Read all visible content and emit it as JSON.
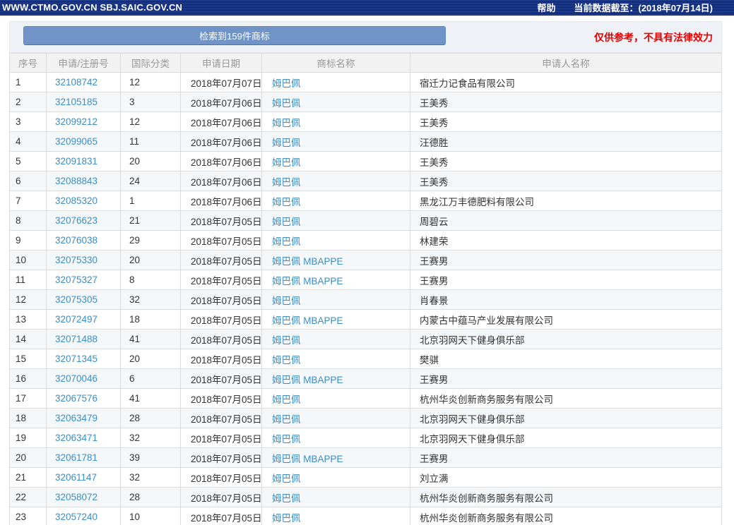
{
  "topbar": {
    "title": "WWW.CTMO.GOV.CN SBJ.SAIC.GOV.CN",
    "help_label": "帮助",
    "data_cutoff": "当前数据截至：(2018年07月14日)"
  },
  "toolbar": {
    "result_count_label": "检索到159件商标",
    "disclaimer": "仅供参考，不具有法律效力"
  },
  "colors": {
    "topbar_base": "#142f80",
    "topbar_stripe": "#24418f",
    "button_blue": "#7094c8",
    "link_blue": "#3d8dc4",
    "disclaimer_red": "#e60000",
    "row_alt": "#f5f8fb",
    "header_bg": "#f2f2f2"
  },
  "table": {
    "columns": [
      "序号",
      "申请/注册号",
      "国际分类",
      "申请日期",
      "商标名称",
      "申请人名称"
    ],
    "rows": [
      {
        "no": "1",
        "reg_no": "32108742",
        "cls": "12",
        "date": "2018年07月07日",
        "mark": "姆巴佩",
        "applicant": "宿迁力记食品有限公司"
      },
      {
        "no": "2",
        "reg_no": "32105185",
        "cls": "3",
        "date": "2018年07月06日",
        "mark": "姆巴佩",
        "applicant": "王美秀"
      },
      {
        "no": "3",
        "reg_no": "32099212",
        "cls": "12",
        "date": "2018年07月06日",
        "mark": "姆巴佩",
        "applicant": "王美秀"
      },
      {
        "no": "4",
        "reg_no": "32099065",
        "cls": "11",
        "date": "2018年07月06日",
        "mark": "姆巴佩",
        "applicant": "汪德胜"
      },
      {
        "no": "5",
        "reg_no": "32091831",
        "cls": "20",
        "date": "2018年07月06日",
        "mark": "姆巴佩",
        "applicant": "王美秀"
      },
      {
        "no": "6",
        "reg_no": "32088843",
        "cls": "24",
        "date": "2018年07月06日",
        "mark": "姆巴佩",
        "applicant": "王美秀"
      },
      {
        "no": "7",
        "reg_no": "32085320",
        "cls": "1",
        "date": "2018年07月06日",
        "mark": "姆巴佩",
        "applicant": "黑龙江万丰德肥料有限公司"
      },
      {
        "no": "8",
        "reg_no": "32076623",
        "cls": "21",
        "date": "2018年07月05日",
        "mark": "姆巴佩",
        "applicant": "周碧云"
      },
      {
        "no": "9",
        "reg_no": "32076038",
        "cls": "29",
        "date": "2018年07月05日",
        "mark": "姆巴佩",
        "applicant": "林建荣"
      },
      {
        "no": "10",
        "reg_no": "32075330",
        "cls": "20",
        "date": "2018年07月05日",
        "mark": "姆巴佩 MBAPPE",
        "applicant": "王赛男"
      },
      {
        "no": "11",
        "reg_no": "32075327",
        "cls": "8",
        "date": "2018年07月05日",
        "mark": "姆巴佩 MBAPPE",
        "applicant": "王赛男"
      },
      {
        "no": "12",
        "reg_no": "32075305",
        "cls": "32",
        "date": "2018年07月05日",
        "mark": "姆巴佩",
        "applicant": "肖春景"
      },
      {
        "no": "13",
        "reg_no": "32072497",
        "cls": "18",
        "date": "2018年07月05日",
        "mark": "姆巴佩 MBAPPE",
        "applicant": "内蒙古中蕴马产业发展有限公司"
      },
      {
        "no": "14",
        "reg_no": "32071488",
        "cls": "41",
        "date": "2018年07月05日",
        "mark": "姆巴佩",
        "applicant": "北京羽网天下健身俱乐部"
      },
      {
        "no": "15",
        "reg_no": "32071345",
        "cls": "20",
        "date": "2018年07月05日",
        "mark": "姆巴佩",
        "applicant": "樊骐"
      },
      {
        "no": "16",
        "reg_no": "32070046",
        "cls": "6",
        "date": "2018年07月05日",
        "mark": "姆巴佩 MBAPPE",
        "applicant": "王赛男"
      },
      {
        "no": "17",
        "reg_no": "32067576",
        "cls": "41",
        "date": "2018年07月05日",
        "mark": "姆巴佩",
        "applicant": "杭州华炎创新商务服务有限公司"
      },
      {
        "no": "18",
        "reg_no": "32063479",
        "cls": "28",
        "date": "2018年07月05日",
        "mark": "姆巴佩",
        "applicant": "北京羽网天下健身俱乐部"
      },
      {
        "no": "19",
        "reg_no": "32063471",
        "cls": "32",
        "date": "2018年07月05日",
        "mark": "姆巴佩",
        "applicant": "北京羽网天下健身俱乐部"
      },
      {
        "no": "20",
        "reg_no": "32061781",
        "cls": "39",
        "date": "2018年07月05日",
        "mark": "姆巴佩 MBAPPE",
        "applicant": "王赛男"
      },
      {
        "no": "21",
        "reg_no": "32061147",
        "cls": "32",
        "date": "2018年07月05日",
        "mark": "姆巴佩",
        "applicant": "刘立满"
      },
      {
        "no": "22",
        "reg_no": "32058072",
        "cls": "28",
        "date": "2018年07月05日",
        "mark": "姆巴佩",
        "applicant": "杭州华炎创新商务服务有限公司"
      },
      {
        "no": "23",
        "reg_no": "32057240",
        "cls": "10",
        "date": "2018年07月05日",
        "mark": "姆巴佩",
        "applicant": "杭州华炎创新商务服务有限公司"
      }
    ]
  }
}
